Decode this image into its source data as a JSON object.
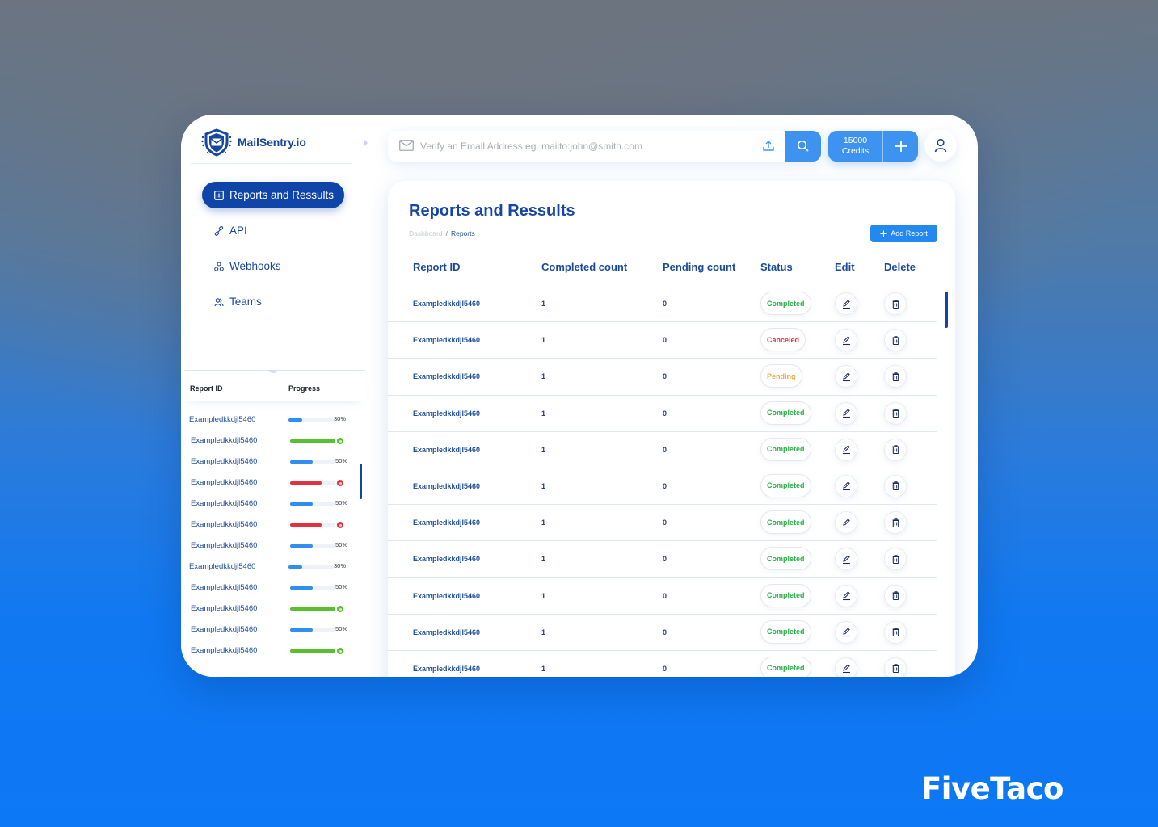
{
  "app": {
    "name": "MailSentry.io"
  },
  "sidebar": {
    "items": [
      {
        "label": "Reports and Ressults",
        "icon": "chart-icon",
        "active": true
      },
      {
        "label": "API",
        "icon": "link-icon",
        "active": false
      },
      {
        "label": "Webhooks",
        "icon": "webhook-icon",
        "active": false
      },
      {
        "label": "Teams",
        "icon": "team-icon",
        "active": false
      }
    ]
  },
  "progress_panel": {
    "headers": {
      "report_id": "Report ID",
      "progress": "Progress"
    },
    "rows": [
      {
        "id": "Exampledkkdjl5460",
        "progress": 30,
        "state": "in-progress",
        "label": "30%"
      },
      {
        "id": "Exampledkkdjl5460",
        "progress": 100,
        "state": "done",
        "label": ""
      },
      {
        "id": "Exampledkkdjl5460",
        "progress": 50,
        "state": "in-progress",
        "label": "50%"
      },
      {
        "id": "Exampledkkdjl5460",
        "progress": 70,
        "state": "failed",
        "label": ""
      },
      {
        "id": "Exampledkkdjl5460",
        "progress": 50,
        "state": "in-progress",
        "label": "50%"
      },
      {
        "id": "Exampledkkdjl5460",
        "progress": 70,
        "state": "failed",
        "label": ""
      },
      {
        "id": "Exampledkkdjl5460",
        "progress": 50,
        "state": "in-progress",
        "label": "50%"
      },
      {
        "id": "Exampledkkdjl5460",
        "progress": 30,
        "state": "in-progress",
        "label": "30%"
      },
      {
        "id": "Exampledkkdjl5460",
        "progress": 50,
        "state": "in-progress",
        "label": "50%"
      },
      {
        "id": "Exampledkkdjl5460",
        "progress": 100,
        "state": "done",
        "label": ""
      },
      {
        "id": "Exampledkkdjl5460",
        "progress": 50,
        "state": "in-progress",
        "label": "50%"
      },
      {
        "id": "Exampledkkdjl5460",
        "progress": 100,
        "state": "done",
        "label": ""
      }
    ]
  },
  "topbar": {
    "search_placeholder": "Verify an Email Address eg. mailto:john@smith.com",
    "search_value": "",
    "credits_amount": "15000",
    "credits_label": "Credits"
  },
  "main": {
    "title": "Reports and Ressults",
    "breadcrumb": {
      "parent": "Dashboard",
      "separator": "/",
      "current": "Reports"
    },
    "add_button": "Add Report",
    "columns": [
      "Report ID",
      "Completed count",
      "Pending count",
      "Status",
      "Edit",
      "Delete"
    ],
    "rows": [
      {
        "id": "Exampledkkdjl5460",
        "completed": "1",
        "pending": "0",
        "status": "Completed"
      },
      {
        "id": "Exampledkkdjl5460",
        "completed": "1",
        "pending": "0",
        "status": "Canceled"
      },
      {
        "id": "Exampledkkdjl5460",
        "completed": "1",
        "pending": "0",
        "status": "Pending"
      },
      {
        "id": "Exampledkkdjl5460",
        "completed": "1",
        "pending": "0",
        "status": "Completed"
      },
      {
        "id": "Exampledkkdjl5460",
        "completed": "1",
        "pending": "0",
        "status": "Completed"
      },
      {
        "id": "Exampledkkdjl5460",
        "completed": "1",
        "pending": "0",
        "status": "Completed"
      },
      {
        "id": "Exampledkkdjl5460",
        "completed": "1",
        "pending": "0",
        "status": "Completed"
      },
      {
        "id": "Exampledkkdjl5460",
        "completed": "1",
        "pending": "0",
        "status": "Completed"
      },
      {
        "id": "Exampledkkdjl5460",
        "completed": "1",
        "pending": "0",
        "status": "Completed"
      },
      {
        "id": "Exampledkkdjl5460",
        "completed": "1",
        "pending": "0",
        "status": "Completed"
      },
      {
        "id": "Exampledkkdjl5460",
        "completed": "1",
        "pending": "0",
        "status": "Completed"
      }
    ]
  },
  "colors": {
    "primary": "#0f44a8",
    "accent": "#3e93f0",
    "status": {
      "Completed": "#2bb04a",
      "Canceled": "#e0333f",
      "Pending": "#f0a64a"
    },
    "progress": {
      "in-progress": "#2e8fee",
      "done": "#5abf2e",
      "failed": "#e0333f"
    }
  },
  "watermark": "FiveTaco"
}
